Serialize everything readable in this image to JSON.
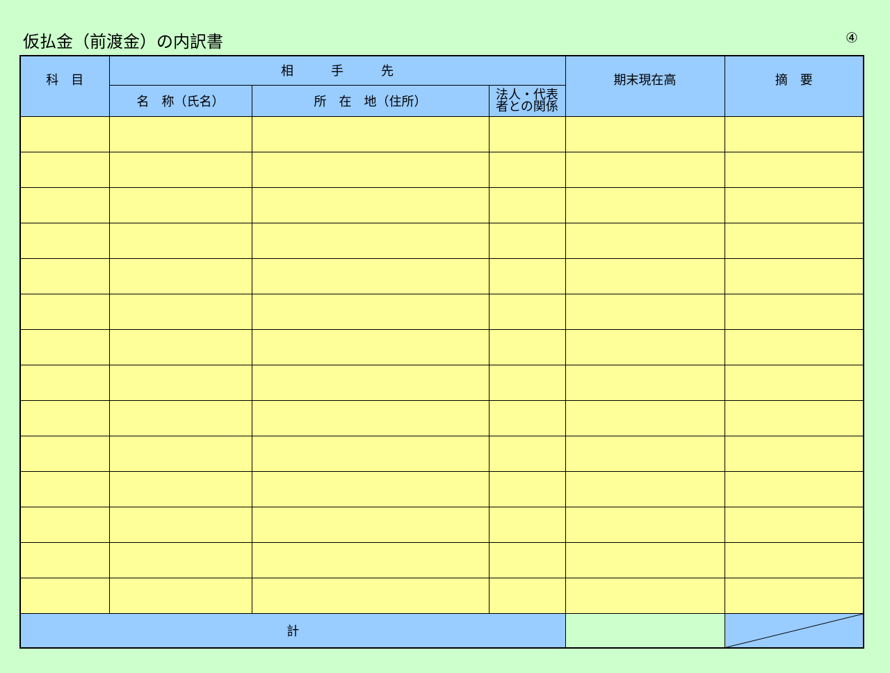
{
  "title": "仮払金（前渡金）の内訳書",
  "page_number": "④",
  "header": {
    "subject": "科　目",
    "counterparty": "相　　　手　　　先",
    "name": "名　称（氏名）",
    "address": "所　在　地（住所）",
    "relation_line1": "法人・代表",
    "relation_line2": "者との関係",
    "balance": "期末現在高",
    "remarks": "摘　要"
  },
  "footer": {
    "total_label": "計"
  },
  "rows": [
    {
      "subject": "",
      "name": "",
      "address": "",
      "relation": "",
      "balance": "",
      "remarks": ""
    },
    {
      "subject": "",
      "name": "",
      "address": "",
      "relation": "",
      "balance": "",
      "remarks": ""
    },
    {
      "subject": "",
      "name": "",
      "address": "",
      "relation": "",
      "balance": "",
      "remarks": ""
    },
    {
      "subject": "",
      "name": "",
      "address": "",
      "relation": "",
      "balance": "",
      "remarks": ""
    },
    {
      "subject": "",
      "name": "",
      "address": "",
      "relation": "",
      "balance": "",
      "remarks": ""
    },
    {
      "subject": "",
      "name": "",
      "address": "",
      "relation": "",
      "balance": "",
      "remarks": ""
    },
    {
      "subject": "",
      "name": "",
      "address": "",
      "relation": "",
      "balance": "",
      "remarks": ""
    },
    {
      "subject": "",
      "name": "",
      "address": "",
      "relation": "",
      "balance": "",
      "remarks": ""
    },
    {
      "subject": "",
      "name": "",
      "address": "",
      "relation": "",
      "balance": "",
      "remarks": ""
    },
    {
      "subject": "",
      "name": "",
      "address": "",
      "relation": "",
      "balance": "",
      "remarks": ""
    },
    {
      "subject": "",
      "name": "",
      "address": "",
      "relation": "",
      "balance": "",
      "remarks": ""
    },
    {
      "subject": "",
      "name": "",
      "address": "",
      "relation": "",
      "balance": "",
      "remarks": ""
    },
    {
      "subject": "",
      "name": "",
      "address": "",
      "relation": "",
      "balance": "",
      "remarks": ""
    },
    {
      "subject": "",
      "name": "",
      "address": "",
      "relation": "",
      "balance": "",
      "remarks": ""
    }
  ],
  "colors": {
    "background": "#ccffcc",
    "header": "#99ccff",
    "input_cell": "#ffff99"
  }
}
